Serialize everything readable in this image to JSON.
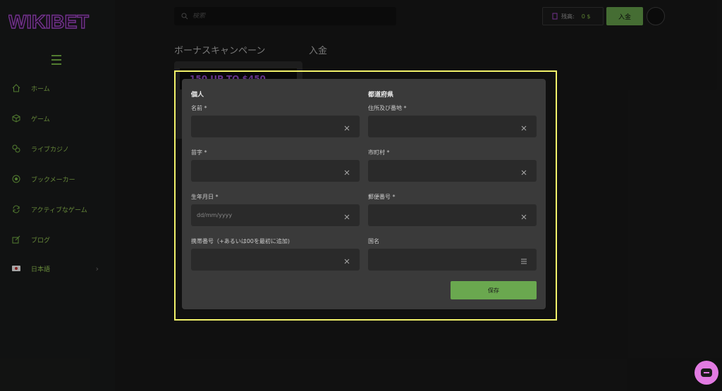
{
  "brand": {
    "logo_text": "WIKIBET"
  },
  "sidebar": {
    "items": [
      {
        "label": "ホーム",
        "icon": "home-icon"
      },
      {
        "label": "ゲーム",
        "icon": "cube-icon"
      },
      {
        "label": "ライブカジノ",
        "icon": "chips-icon"
      },
      {
        "label": "ブックメーカー",
        "icon": "soccer-ball-icon"
      },
      {
        "label": "アクティブなゲーム",
        "icon": "recycle-icon"
      },
      {
        "label": "ブログ",
        "icon": "edit-icon"
      },
      {
        "label": "日本語",
        "icon": "japan-flag-icon"
      }
    ]
  },
  "header": {
    "search_placeholder": "検索",
    "balance_label": "残高:",
    "balance_amount": "0 $",
    "deposit_label": "入金"
  },
  "page": {
    "tabs": [
      "ボーナスキャンペーン",
      "入金"
    ],
    "promo_title": "150 UP TO $450"
  },
  "modal": {
    "left_title": "個人",
    "right_title": "都道府県",
    "fields": {
      "first_name": {
        "label": "名前 *",
        "placeholder": ""
      },
      "last_name": {
        "label": "苗字 *",
        "placeholder": ""
      },
      "birth_date": {
        "label": "生年月日 *",
        "placeholder": "dd/mm/yyyy"
      },
      "phone": {
        "label": "携帯番号（+あるいは00を最初に追加)",
        "placeholder": ""
      },
      "address": {
        "label": "住所及び番地 *",
        "placeholder": ""
      },
      "city": {
        "label": "市町村 *",
        "placeholder": ""
      },
      "postal_code": {
        "label": "郵便番号 *",
        "placeholder": ""
      },
      "country": {
        "label": "国名",
        "placeholder": ""
      }
    },
    "save_label": "保存"
  },
  "colors": {
    "accent": "#6aa84f",
    "highlight": "#f2f26a",
    "brand": "#9b4dd8"
  }
}
